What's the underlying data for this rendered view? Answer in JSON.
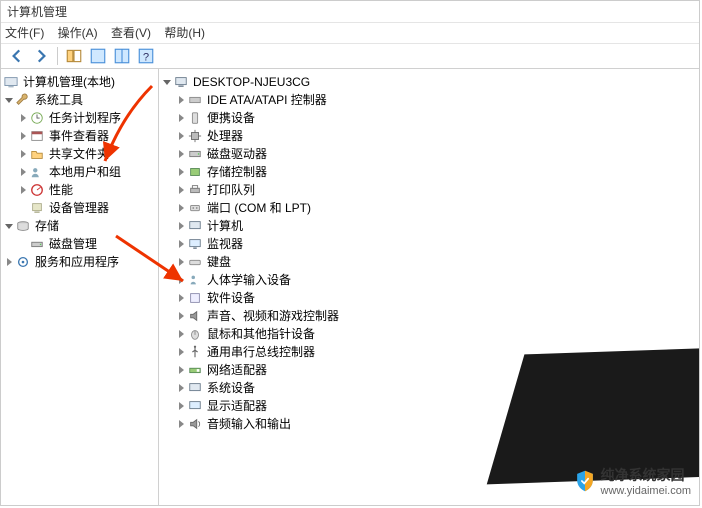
{
  "title": "计算机管理",
  "menu": {
    "file": "文件(F)",
    "action": "操作(A)",
    "view": "查看(V)",
    "help": "帮助(H)"
  },
  "left_tree": {
    "root": "计算机管理(本地)",
    "system_tools": {
      "label": "系统工具",
      "children": {
        "task_scheduler": "任务计划程序",
        "event_viewer": "事件查看器",
        "shared_folders": "共享文件夹",
        "local_users": "本地用户和组",
        "performance": "性能",
        "device_manager": "设备管理器"
      }
    },
    "storage": {
      "label": "存储",
      "children": {
        "disk_mgmt": "磁盘管理"
      }
    },
    "services": "服务和应用程序"
  },
  "right_tree": {
    "computer": "DESKTOP-NJEU3CG",
    "ide": "IDE ATA/ATAPI 控制器",
    "portable": "便携设备",
    "processor": "处理器",
    "disk_drives": "磁盘驱动器",
    "storage_ctrl": "存储控制器",
    "print_queues": "打印队列",
    "ports": "端口 (COM 和 LPT)",
    "computers": "计算机",
    "monitors": "监视器",
    "keyboards": "键盘",
    "hid": "人体学输入设备",
    "software": "软件设备",
    "audio_video": "声音、视频和游戏控制器",
    "mice": "鼠标和其他指针设备",
    "usb": "通用串行总线控制器",
    "network": "网络适配器",
    "system_devices": "系统设备",
    "display": "显示适配器",
    "audio_io": "音频输入和输出"
  },
  "watermark": {
    "brand": "纯净系统家园",
    "url": "www.yidaimei.com"
  }
}
